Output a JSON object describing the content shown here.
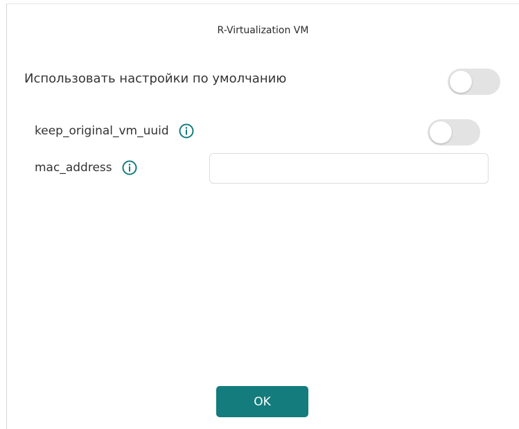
{
  "dialog": {
    "title": "R-Virtualization VM"
  },
  "defaults": {
    "label": "Использовать настройки по умолчанию",
    "enabled": false
  },
  "fields": {
    "keep_uuid": {
      "label": "keep_original_vm_uuid",
      "icon": "info-icon",
      "enabled": false
    },
    "mac_address": {
      "label": "mac_address",
      "icon": "info-icon",
      "value": "",
      "placeholder": ""
    }
  },
  "actions": {
    "ok_label": "OK"
  },
  "colors": {
    "accent": "#147c7c",
    "toggle_off": "#e3e3e3",
    "text": "#333333"
  }
}
